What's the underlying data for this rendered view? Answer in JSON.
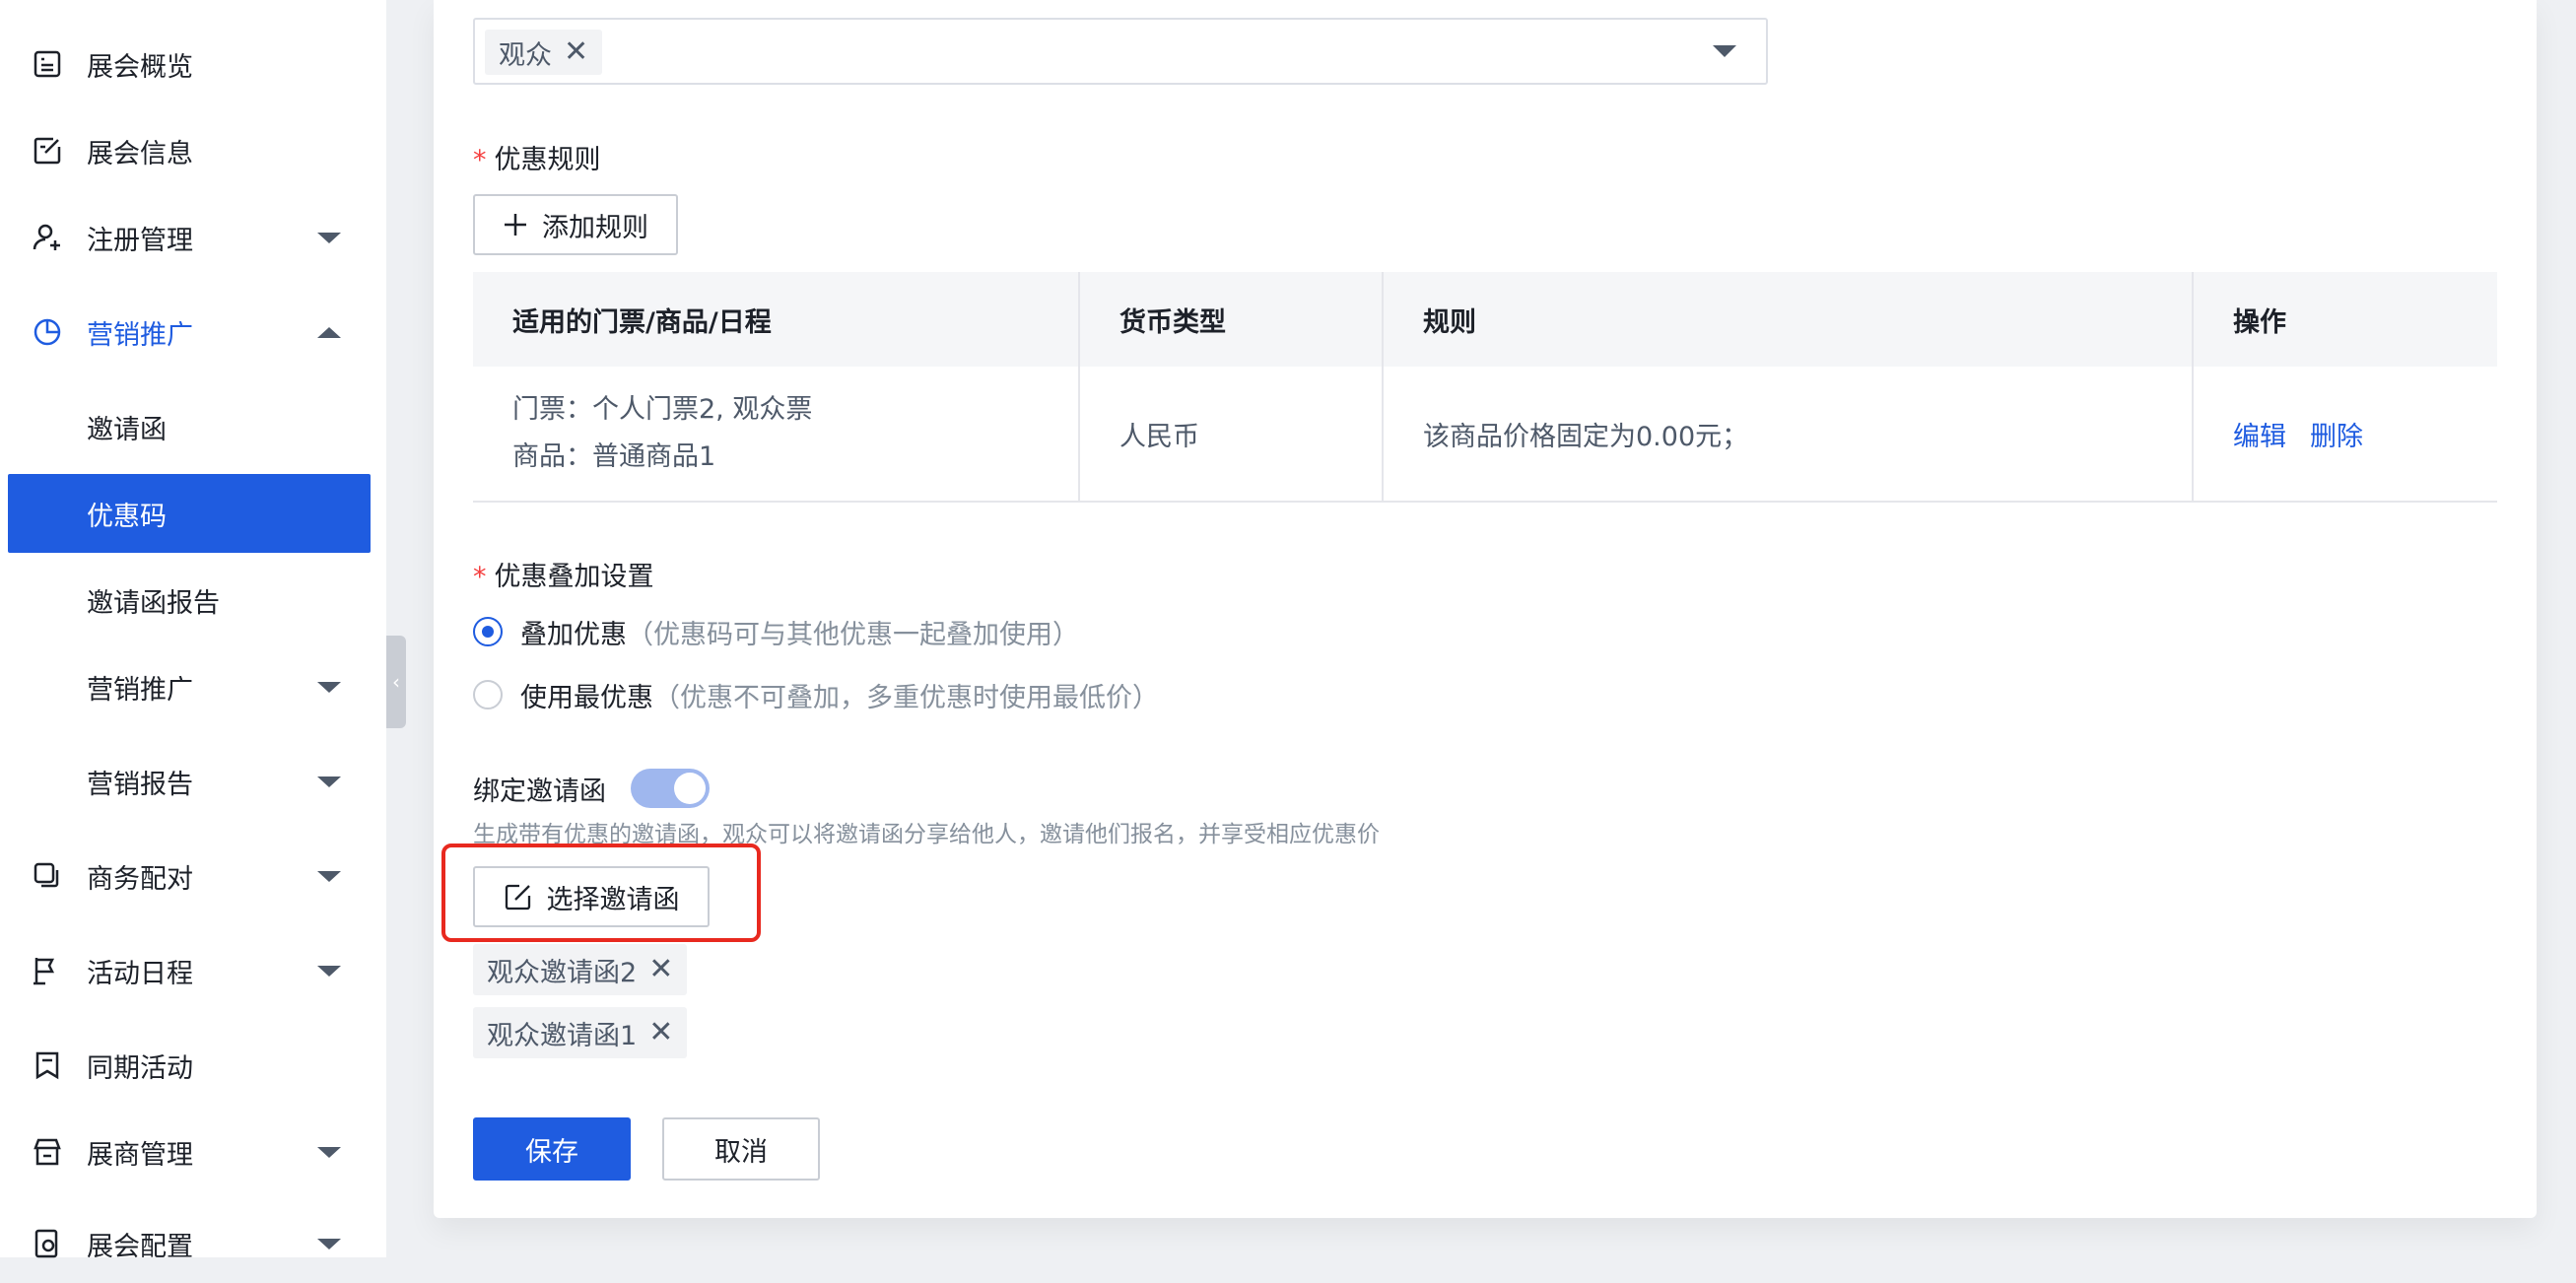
{
  "sidebar": {
    "items": [
      {
        "label": "展会概览",
        "icon": "dashboard-icon"
      },
      {
        "label": "展会信息",
        "icon": "edit-doc-icon"
      },
      {
        "label": "注册管理",
        "icon": "user-add-icon"
      },
      {
        "label": "营销推广",
        "icon": "pie-chart-icon"
      },
      {
        "label": "邀请函"
      },
      {
        "label": "优惠码"
      },
      {
        "label": "邀请函报告"
      },
      {
        "label": "营销推广"
      },
      {
        "label": "营销报告"
      },
      {
        "label": "商务配对",
        "icon": "copy-icon"
      },
      {
        "label": "活动日程",
        "icon": "flag-icon"
      },
      {
        "label": "同期活动",
        "icon": "bookmark-icon"
      },
      {
        "label": "展商管理",
        "icon": "store-icon"
      },
      {
        "label": "展会配置",
        "icon": "settings-doc-icon"
      }
    ],
    "collapse_glyph": "‹"
  },
  "audience_select": {
    "tag": "观众",
    "remove_glyph": "✕"
  },
  "discount_rules": {
    "label": "优惠规则",
    "add_button": "添加规则",
    "columns": [
      "适用的门票/商品/日程",
      "货币类型",
      "规则",
      "操作"
    ],
    "rows": [
      {
        "applicable_line1": "门票：个人门票2, 观众票",
        "applicable_line2": "商品：普通商品1",
        "currency": "人民币",
        "rule": "该商品价格固定为0.00元；",
        "edit": "编辑",
        "delete": "删除"
      }
    ]
  },
  "stacking": {
    "label": "优惠叠加设置",
    "options": [
      {
        "label": "叠加优惠",
        "hint": "（优惠码可与其他优惠一起叠加使用）",
        "selected": true
      },
      {
        "label": "使用最优惠",
        "hint": "（优惠不可叠加，多重优惠时使用最低价）",
        "selected": false
      }
    ]
  },
  "bind_invitation": {
    "label": "绑定邀请函",
    "enabled": true,
    "hint": "生成带有优惠的邀请函，观众可以将邀请函分享给他人，邀请他们报名，并享受相应优惠价",
    "select_button": "选择邀请函",
    "tags": [
      "观众邀请函2",
      "观众邀请函1"
    ]
  },
  "actions": {
    "save": "保存",
    "cancel": "取消"
  },
  "colors": {
    "primary": "#1f5ce0",
    "required": "#f53f3f",
    "highlight": "#e8291f"
  }
}
